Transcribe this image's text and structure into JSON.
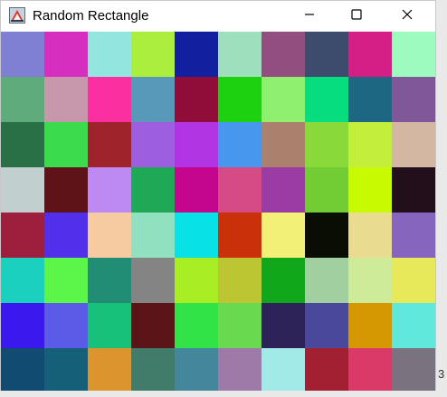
{
  "window": {
    "title": "Random Rectangle",
    "icon": "java-app-icon"
  },
  "controls": {
    "minimize_icon": "minimize-icon",
    "maximize_icon": "maximize-icon",
    "close_icon": "close-icon"
  },
  "edge_text": "3",
  "grid": {
    "columns": 10,
    "rows": 8,
    "colors": [
      [
        "#7f7fd4",
        "#d62fc0",
        "#93e6df",
        "#acee3d",
        "#1220a0",
        "#9edfbe",
        "#924e7e",
        "#3d4c6c",
        "#d51f87",
        "#9efbc0"
      ],
      [
        "#5fab7c",
        "#c797ab",
        "#fb2fa0",
        "#5898b8",
        "#8f0d38",
        "#1dd111",
        "#8fef6e",
        "#05dd7e",
        "#1e6782",
        "#80589a"
      ],
      [
        "#2a7046",
        "#3cdb4d",
        "#9f232b",
        "#9d5fe0",
        "#b235e3",
        "#4797ef",
        "#ab816d",
        "#89d93a",
        "#c3ef3c",
        "#d3b7a3"
      ],
      [
        "#c1d0cf",
        "#5e1318",
        "#bd89f3",
        "#1fa855",
        "#c4068e",
        "#d64b85",
        "#9b3ca4",
        "#72cc34",
        "#c8fb01",
        "#230f1c"
      ],
      [
        "#9d1f3d",
        "#522fea",
        "#f6cba1",
        "#91e1c1",
        "#08e1e5",
        "#ca300a",
        "#f3f078",
        "#0a0d03",
        "#e9dc91",
        "#8665bf"
      ],
      [
        "#1bd0be",
        "#5cf64a",
        "#218d75",
        "#858485",
        "#a9ed25",
        "#bcc532",
        "#11a71b",
        "#a2cfa0",
        "#cdeb98",
        "#e8e95a"
      ],
      [
        "#3b18ed",
        "#5b5be8",
        "#17c17a",
        "#5b1519",
        "#32e348",
        "#69d94f",
        "#2e2358",
        "#4a489b",
        "#d69802",
        "#60e8dd"
      ],
      [
        "#124b72",
        "#165f78",
        "#dc942e",
        "#417b6a",
        "#44869c",
        "#9e7aa8",
        "#a2eae7",
        "#a22031",
        "#d93a67",
        "#7a727f"
      ]
    ]
  }
}
